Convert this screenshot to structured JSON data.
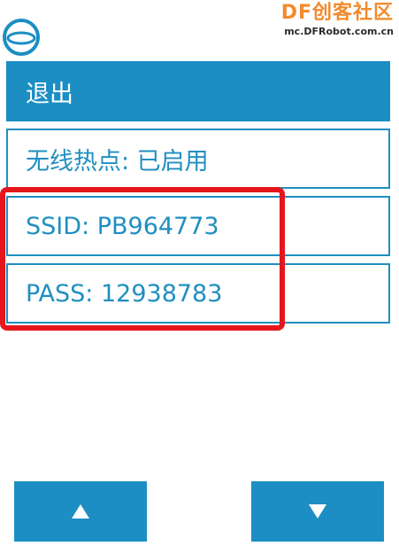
{
  "watermark": {
    "brand_df": "DF",
    "brand_cn": "创客社区",
    "site": "mc.DFRobot.com.cn"
  },
  "menu": {
    "exit_label": "退出",
    "hotspot_label": "无线热点: 已启用",
    "ssid_label": "SSID: PB964773",
    "pass_label": "PASS: 12938783"
  },
  "nav": {
    "up_icon": "triangle-up-icon",
    "down_icon": "triangle-down-icon"
  },
  "colors": {
    "accent": "#1c8ec3",
    "highlight": "#e5161c",
    "watermark": "#f28a2e"
  }
}
